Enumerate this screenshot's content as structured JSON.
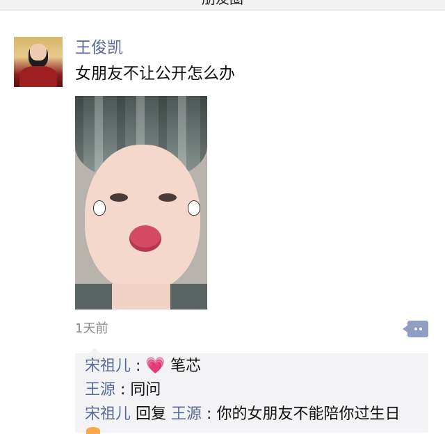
{
  "header": {
    "title": "朋友圈"
  },
  "post": {
    "author": "王俊凯",
    "text": "女朋友不让公开怎么办",
    "time": "1天前"
  },
  "comments": [
    {
      "name": "宋祖儿",
      "sep": ": ",
      "emoji": "💗",
      "text": "笔芯"
    },
    {
      "name": "王源",
      "sep": ": ",
      "text": "同问"
    },
    {
      "name": "宋祖儿",
      "reply_label": "回复",
      "reply_to": "王源",
      "sep": ": ",
      "text": "你的女朋友不能陪你过生日"
    }
  ],
  "icons": {
    "more": "comment-more-icon"
  },
  "colors": {
    "link_name": "#576b95",
    "comment_bg": "#f3f3f5",
    "more_button": "#8f9fc4"
  }
}
